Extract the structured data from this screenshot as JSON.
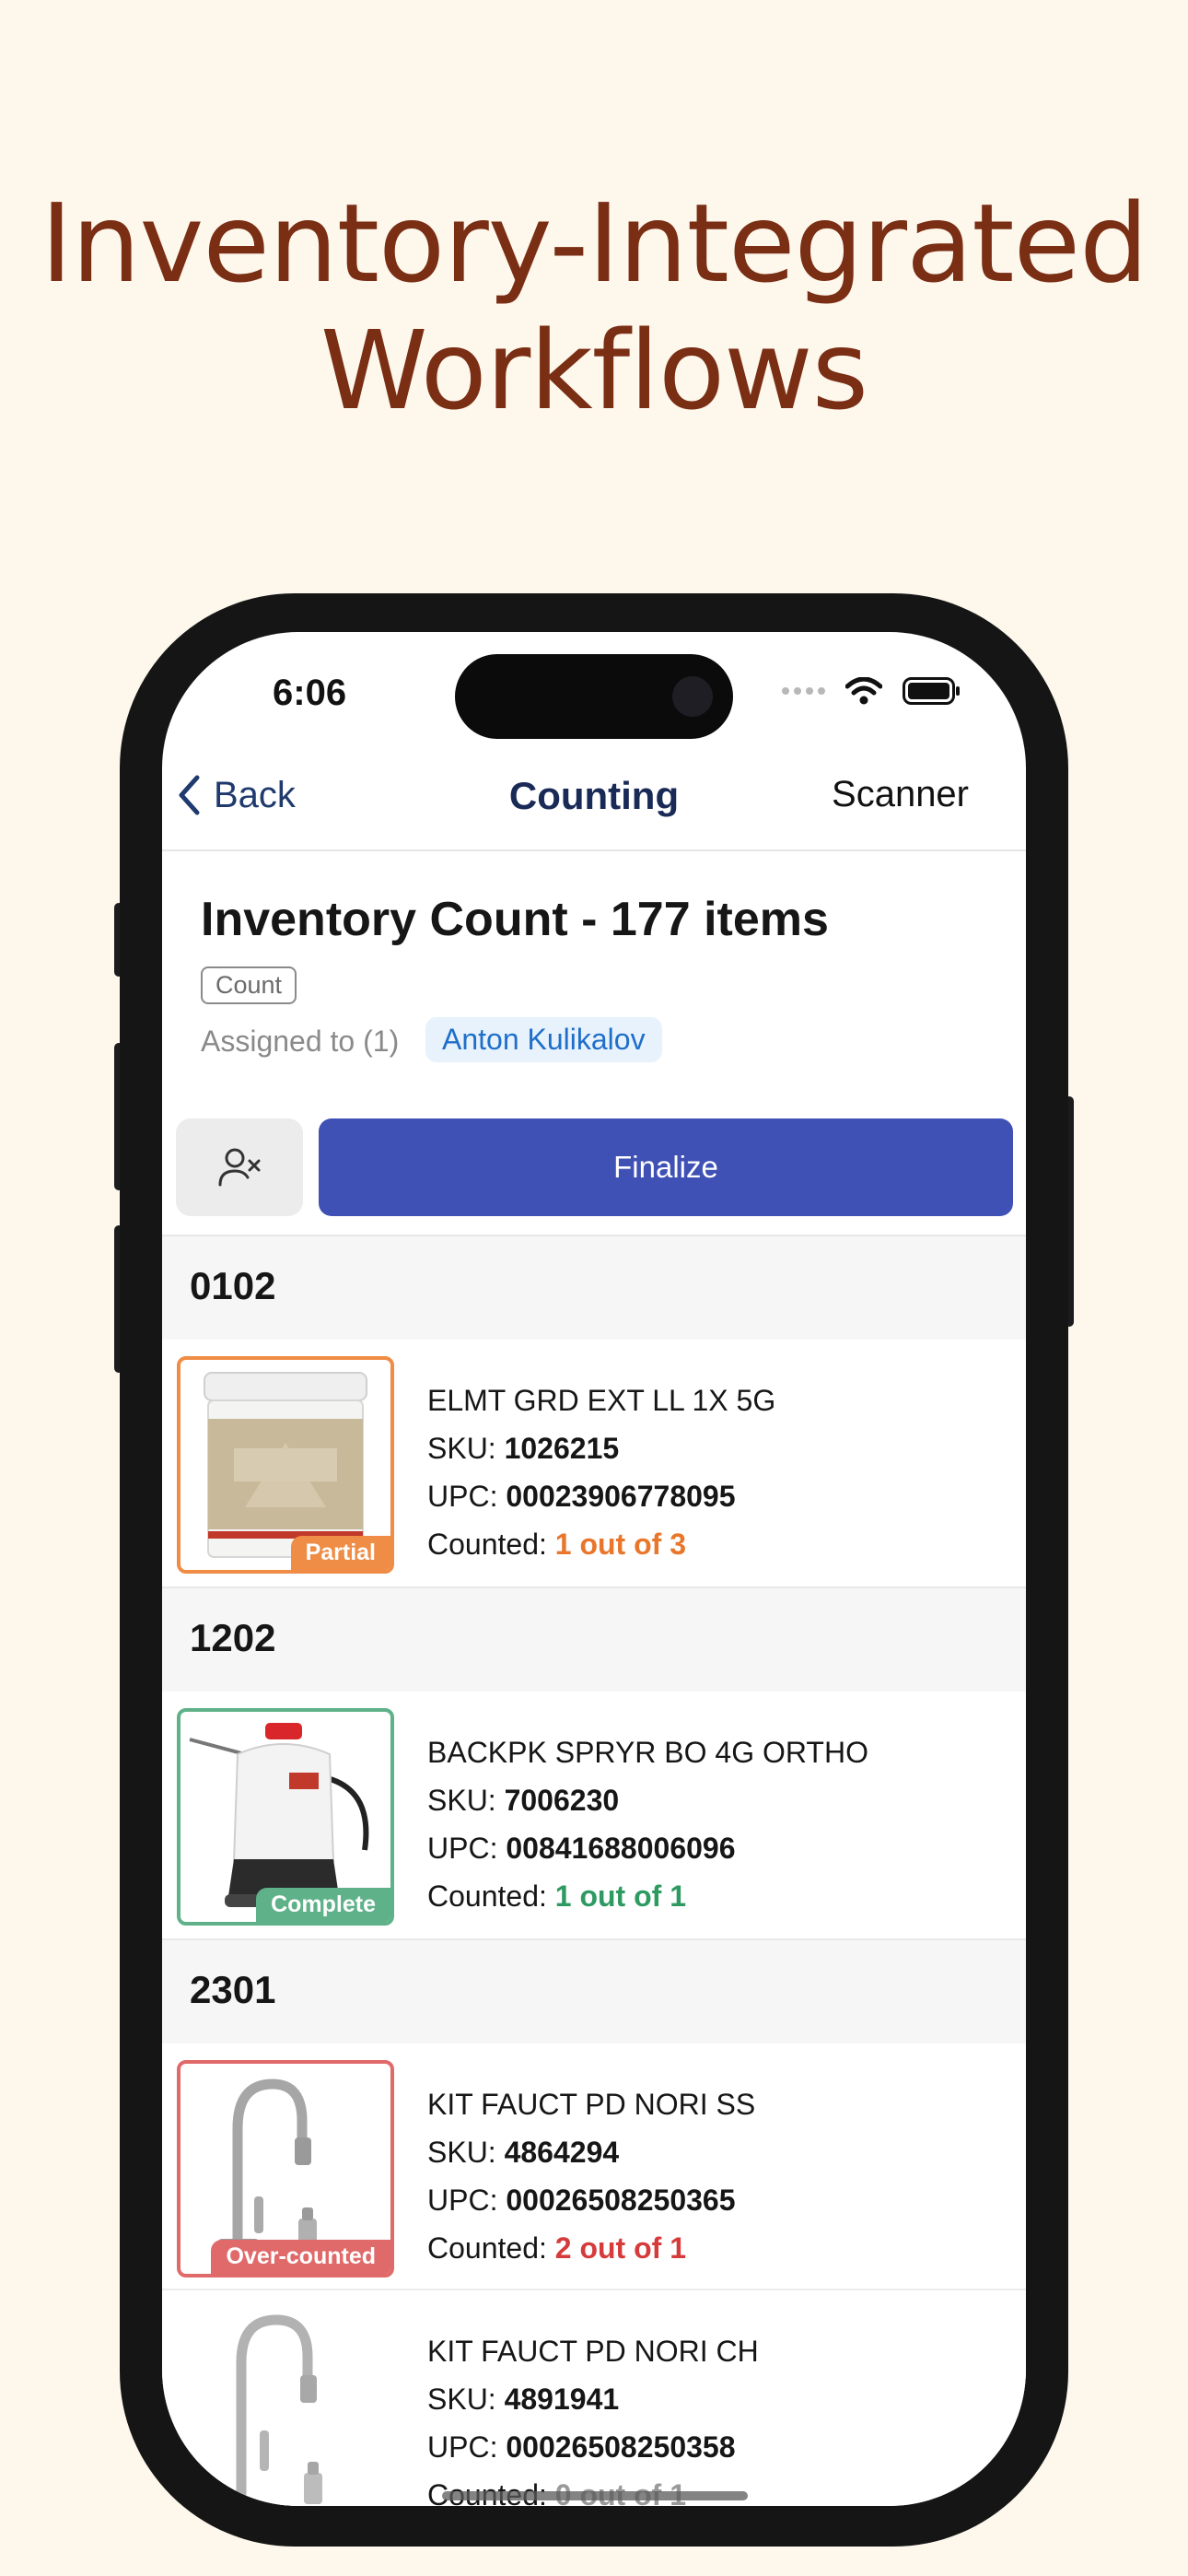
{
  "headline": {
    "line1": "Inventory-Integrated",
    "line2": "Workflows"
  },
  "status_bar": {
    "time": "6:06"
  },
  "nav": {
    "back_label": "Back",
    "title": "Counting",
    "right_label": "Scanner"
  },
  "task": {
    "title": "Inventory Count - 177 items",
    "type_chip": "Count",
    "assigned_label": "Assigned to (1)",
    "assignee": "Anton Kulikalov"
  },
  "actions": {
    "finalize_label": "Finalize",
    "unassign_icon": "user-remove-icon"
  },
  "labels": {
    "sku": "SKU:",
    "upc": "UPC:",
    "counted": "Counted:"
  },
  "colors": {
    "partial": "#ef8c45",
    "complete": "#5fb189",
    "over": "#e06a6a",
    "accent": "#3f51b5"
  },
  "sections": [
    {
      "label": "0102",
      "items": [
        {
          "name": "ELMT GRD EXT LL 1X 5G",
          "sku": "1026215",
          "upc": "00023906778095",
          "counted": "1 out of 3",
          "status": "Partial",
          "image": "paint-bucket-icon"
        }
      ]
    },
    {
      "label": "1202",
      "items": [
        {
          "name": "BACKPK SPRYR BO 4G ORTHO",
          "sku": "7006230",
          "upc": "00841688006096",
          "counted": "1 out of 1",
          "status": "Complete",
          "image": "backpack-sprayer-icon"
        }
      ]
    },
    {
      "label": "2301",
      "items": [
        {
          "name": "KIT FAUCT PD NORI SS",
          "sku": "4864294",
          "upc": "00026508250365",
          "counted": "2 out of 1",
          "status": "Over-counted",
          "image": "faucet-icon"
        },
        {
          "name": "KIT FAUCT PD NORI CH",
          "sku": "4891941",
          "upc": "00026508250358",
          "counted": "0 out of 1",
          "status": "",
          "image": "faucet-icon"
        }
      ]
    }
  ]
}
